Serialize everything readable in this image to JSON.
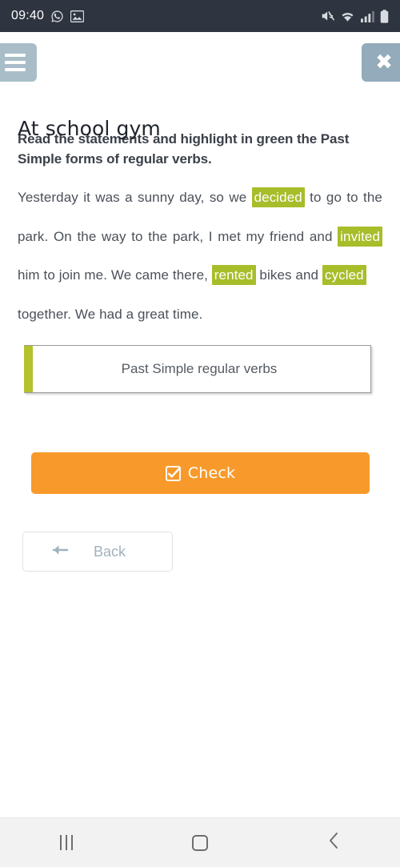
{
  "status_bar": {
    "time": "09:40",
    "left_icons": [
      "whatsapp-icon",
      "gallery-image-icon"
    ],
    "right_icons": [
      "mute-icon",
      "wifi-icon",
      "signal-icon",
      "battery-icon"
    ],
    "background_color": "#2e3440"
  },
  "header": {
    "menu_icon": "hamburger-menu-icon",
    "close_icon": "close-x-icon",
    "title": "At school gym",
    "button_color": "#a9bdc9"
  },
  "task": {
    "instruction": "Read the statements and highlight in green the Past Simple forms of regular verbs.",
    "highlight_color": "#a8bd2a",
    "passage_segments": [
      {
        "text": "Yesterday it was a sunny day, so we ",
        "highlighted": false
      },
      {
        "text": "decided",
        "highlighted": true
      },
      {
        "text": " to go to the park. On the way to the park, I met my friend and ",
        "highlighted": false
      },
      {
        "text": "invited",
        "highlighted": true
      },
      {
        "text": " him to join me. We came there, ",
        "highlighted": false
      },
      {
        "text": "rented",
        "highlighted": true
      },
      {
        "text": " bikes and ",
        "highlighted": false
      },
      {
        "text": "cycled",
        "highlighted": true
      },
      {
        "text": " together. We had a great time.",
        "highlighted": false
      }
    ],
    "passage_lines": [
      "Yesterday it was a sunny day, so we decided",
      "to go to the park. On the way to the park, I",
      "met my friend and invited him to join me.",
      "We came there, rented bikes and cycled",
      "together. We had a great time."
    ],
    "highlighted_words": [
      "decided",
      "invited",
      "rented",
      "cycled"
    ]
  },
  "answer_box": {
    "label": "Past Simple regular verbs",
    "accent_color": "#b4c22c"
  },
  "actions": {
    "check_label": "Check",
    "check_icon": "checked-box-icon",
    "check_color": "#f89a2b",
    "back_label": "Back",
    "back_icon": "arrow-left-icon"
  },
  "nav_bar": {
    "recents_label": "recents-icon",
    "home_label": "home-icon",
    "back_label": "back-chevron-icon"
  }
}
